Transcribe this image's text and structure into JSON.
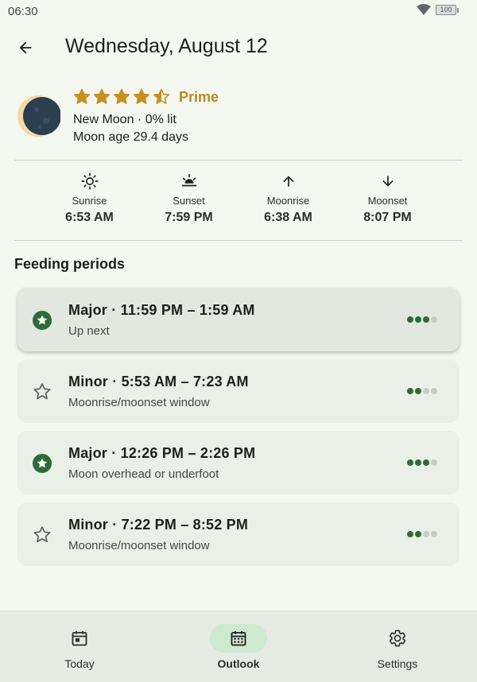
{
  "status_bar": {
    "time": "06:30",
    "battery": "100"
  },
  "header": {
    "title": "Wednesday, August 12"
  },
  "summary": {
    "rating": 4.5,
    "rating_max": 5,
    "rating_label": "Prime",
    "phase_text": "New Moon · 0% lit",
    "age_text": "Moon age 29.4 days"
  },
  "sun_moon": [
    {
      "icon": "sun-icon",
      "label": "Sunrise",
      "value": "6:53 AM"
    },
    {
      "icon": "sunset-icon",
      "label": "Sunset",
      "value": "7:59 PM"
    },
    {
      "icon": "arrow-up-icon",
      "label": "Moonrise",
      "value": "6:38 AM"
    },
    {
      "icon": "arrow-down-icon",
      "label": "Moonset",
      "value": "8:07 PM"
    }
  ],
  "feeding": {
    "section_title": "Feeding periods",
    "periods": [
      {
        "title": "Major · 11:59 PM – 1:59 AM",
        "subtitle": "Up next",
        "type": "major",
        "strength": 3,
        "strength_max": 4
      },
      {
        "title": "Minor · 5:53 AM – 7:23 AM",
        "subtitle": "Moonrise/moonset window",
        "type": "minor",
        "strength": 2,
        "strength_max": 4
      },
      {
        "title": "Major · 12:26 PM – 2:26 PM",
        "subtitle": "Moon overhead or underfoot",
        "type": "major",
        "strength": 3,
        "strength_max": 4
      },
      {
        "title": "Minor · 7:22 PM – 8:52 PM",
        "subtitle": "Moonrise/moonset window",
        "type": "minor",
        "strength": 2,
        "strength_max": 4
      }
    ]
  },
  "nav": {
    "items": [
      {
        "label": "Today",
        "icon": "calendar-today-icon",
        "active": false
      },
      {
        "label": "Outlook",
        "icon": "calendar-month-icon",
        "active": true
      },
      {
        "label": "Settings",
        "icon": "gear-icon",
        "active": false
      }
    ]
  },
  "colors": {
    "accent_green": "#2e6b3a",
    "star_gold": "#c8901e",
    "prime_text": "#b98a1e",
    "dot_inactive": "#c8ccc5"
  }
}
